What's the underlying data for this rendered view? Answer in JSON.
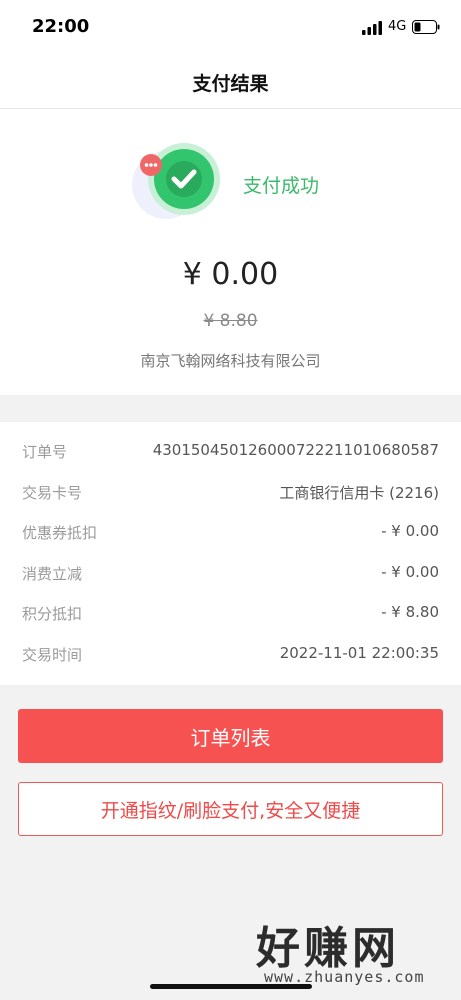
{
  "status_bar": {
    "time": "22:00",
    "network": "4G"
  },
  "nav": {
    "title": "支付结果"
  },
  "result": {
    "status_text": "支付成功",
    "amount": "¥ 0.00",
    "original_amount": "¥ 8.80",
    "merchant": "南京飞翰网络科技有限公司"
  },
  "details": {
    "rows": [
      {
        "label": "订单号",
        "value": "430150450126000722211010680587"
      },
      {
        "label": "交易卡号",
        "value": "工商银行信用卡 (2216)"
      },
      {
        "label": "优惠券抵扣",
        "value": "- ¥ 0.00"
      },
      {
        "label": "消费立减",
        "value": "- ¥ 0.00"
      },
      {
        "label": "积分抵扣",
        "value": "- ¥ 8.80"
      },
      {
        "label": "交易时间",
        "value": "2022-11-01 22:00:35"
      }
    ]
  },
  "actions": {
    "order_list": "订单列表",
    "enable_biometric": "开通指纹/刷脸支付,安全又便捷"
  },
  "watermark": {
    "brand": "好赚网",
    "url": "www.zhuanyes.com"
  },
  "colors": {
    "success": "#3cb96b",
    "primary_button": "#f55251",
    "secondary_border": "#ee5858"
  }
}
